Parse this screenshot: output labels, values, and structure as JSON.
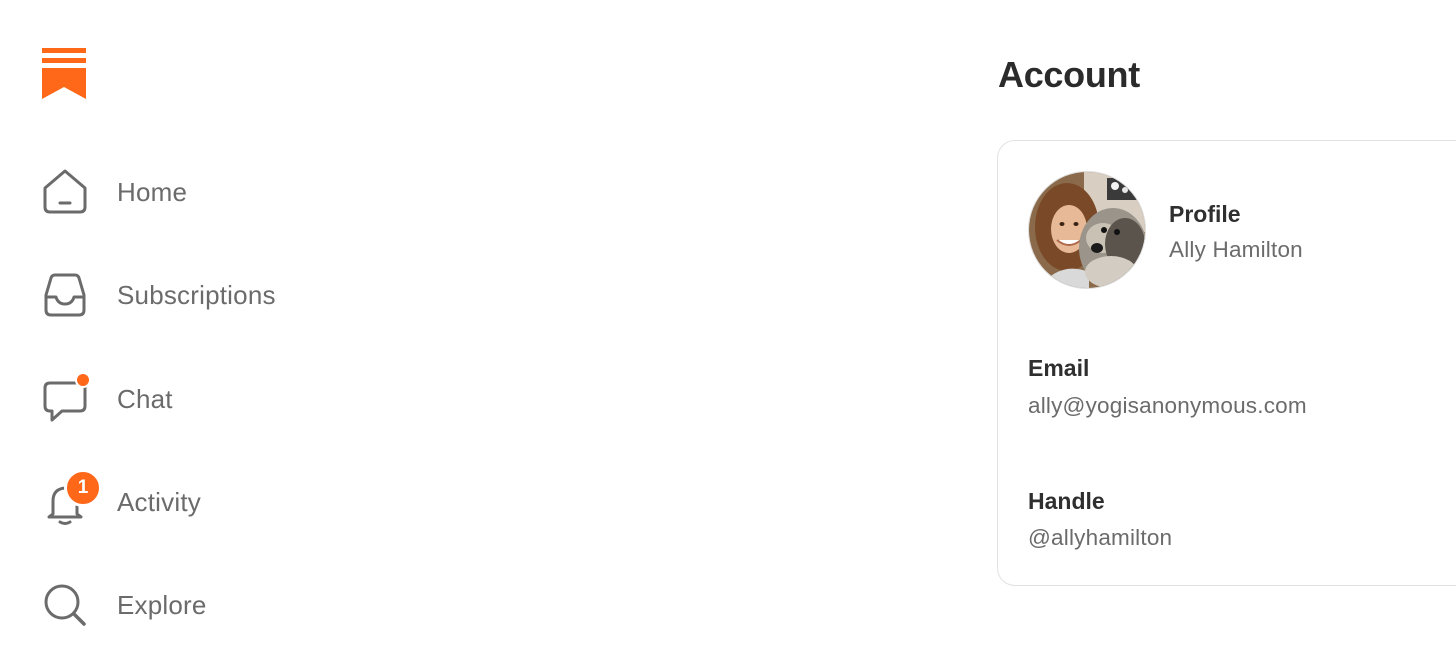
{
  "brand": {
    "logo_icon": "substack-bookmark-icon",
    "accent": "#ff6719"
  },
  "nav": {
    "items": [
      {
        "label": "Home",
        "icon": "home-icon"
      },
      {
        "label": "Subscriptions",
        "icon": "inbox-icon"
      },
      {
        "label": "Chat",
        "icon": "chat-bubble-icon",
        "has_dot": true
      },
      {
        "label": "Activity",
        "icon": "bell-icon",
        "badge": "1"
      },
      {
        "label": "Explore",
        "icon": "search-icon"
      }
    ]
  },
  "account": {
    "title": "Account",
    "profile": {
      "label": "Profile",
      "name": "Ally Hamilton",
      "avatar_icon": "avatar-photo"
    },
    "email": {
      "label": "Email",
      "value": "ally@yogisanonymous.com"
    },
    "handle": {
      "label": "Handle",
      "value": "@allyhamilton"
    }
  }
}
